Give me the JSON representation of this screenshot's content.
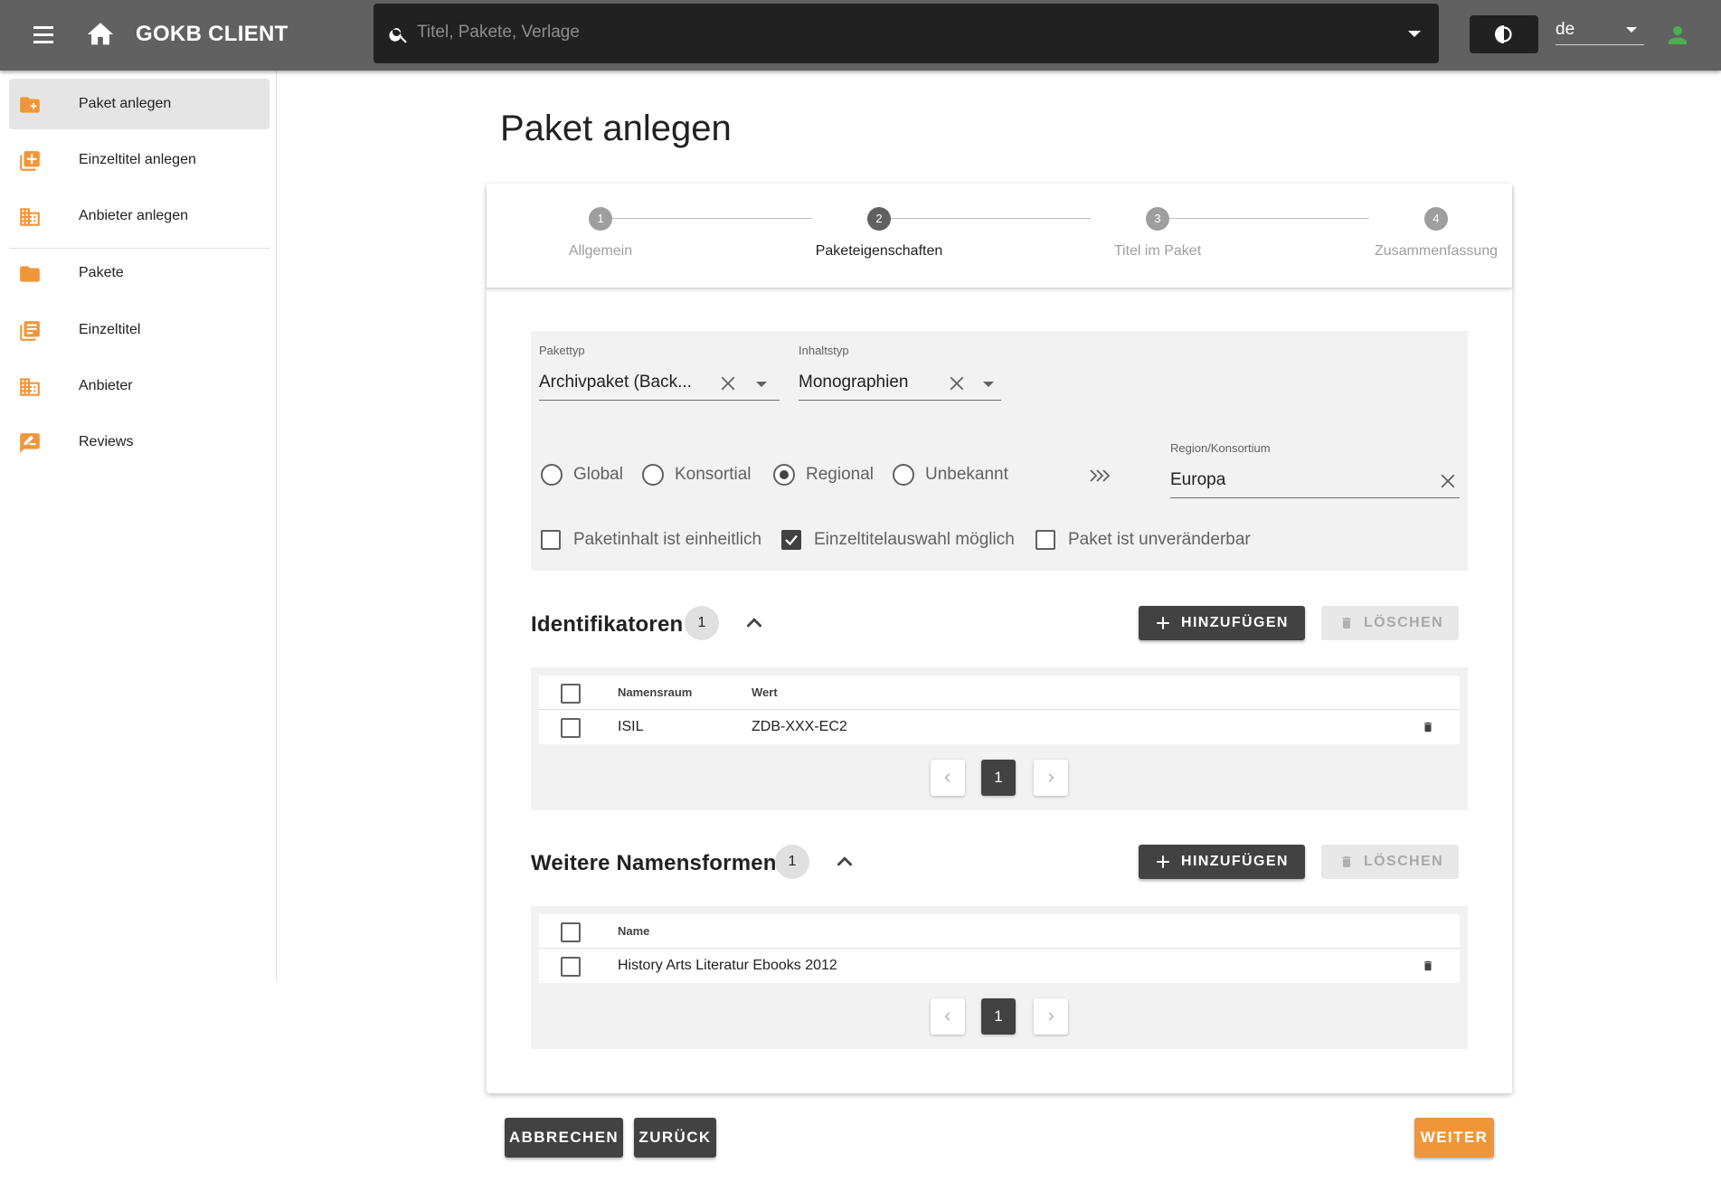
{
  "colors": {
    "appbar": "#616161",
    "search_bg": "#212121",
    "accent": "#f0963a",
    "nav_icon": "#f0963a",
    "user_icon": "#4caf50",
    "button_dark": "#424242"
  },
  "appbar": {
    "title": "GOKB CLIENT",
    "search_placeholder": "Titel, Pakete, Verlage",
    "language": "de",
    "icons": {
      "menu": "menu-icon",
      "home": "home-icon",
      "search": "search-icon",
      "theme": "contrast-icon",
      "user": "account-icon"
    }
  },
  "sidebar": {
    "items": [
      {
        "label": "Paket anlegen",
        "icon": "folder-plus-icon",
        "active": true
      },
      {
        "label": "Einzeltitel anlegen",
        "icon": "library-add-icon",
        "active": false
      },
      {
        "label": "Anbieter anlegen",
        "icon": "domain-icon",
        "active": false
      },
      {
        "label": "Pakete",
        "icon": "folder-icon",
        "active": false
      },
      {
        "label": "Einzeltitel",
        "icon": "library-books-icon",
        "active": false
      },
      {
        "label": "Anbieter",
        "icon": "domain-icon",
        "active": false
      },
      {
        "label": "Reviews",
        "icon": "rate-review-icon",
        "active": false
      }
    ]
  },
  "page": {
    "title": "Paket anlegen"
  },
  "stepper": {
    "current": 2,
    "steps": [
      {
        "number": "1",
        "label": "Allgemein"
      },
      {
        "number": "2",
        "label": "Paketeigenschaften"
      },
      {
        "number": "3",
        "label": "Titel im Paket"
      },
      {
        "number": "4",
        "label": "Zusammenfassung"
      }
    ]
  },
  "properties": {
    "package_type": {
      "label": "Pakettyp",
      "value": "Archivpaket (Back..."
    },
    "content_type": {
      "label": "Inhaltstyp",
      "value": "Monographien"
    },
    "scope_options": [
      {
        "label": "Global",
        "selected": false
      },
      {
        "label": "Konsortial",
        "selected": false
      },
      {
        "label": "Regional",
        "selected": true
      },
      {
        "label": "Unbekannt",
        "selected": false
      }
    ],
    "region": {
      "label": "Region/Konsortium",
      "value": "Europa"
    },
    "checkboxes": [
      {
        "label": "Paketinhalt ist einheitlich",
        "checked": false
      },
      {
        "label": "Einzeltitelauswahl möglich",
        "checked": true
      },
      {
        "label": "Paket ist unveränderbar",
        "checked": false
      }
    ]
  },
  "identifiers": {
    "title": "Identifikatoren",
    "count": "1",
    "add_label": "HINZUFÜGEN",
    "delete_label": "LÖSCHEN",
    "columns": [
      "Namensraum",
      "Wert"
    ],
    "rows": [
      {
        "namespace": "ISIL",
        "value": "ZDB-XXX-EC2"
      }
    ],
    "page": "1"
  },
  "alt_names": {
    "title": "Weitere Namensformen",
    "count": "1",
    "add_label": "HINZUFÜGEN",
    "delete_label": "LÖSCHEN",
    "columns": [
      "Name"
    ],
    "rows": [
      {
        "name": "History Arts Literatur Ebooks 2012"
      }
    ],
    "page": "1"
  },
  "footer": {
    "cancel_label": "ABBRECHEN",
    "back_label": "ZURÜCK",
    "next_label": "WEITER"
  }
}
